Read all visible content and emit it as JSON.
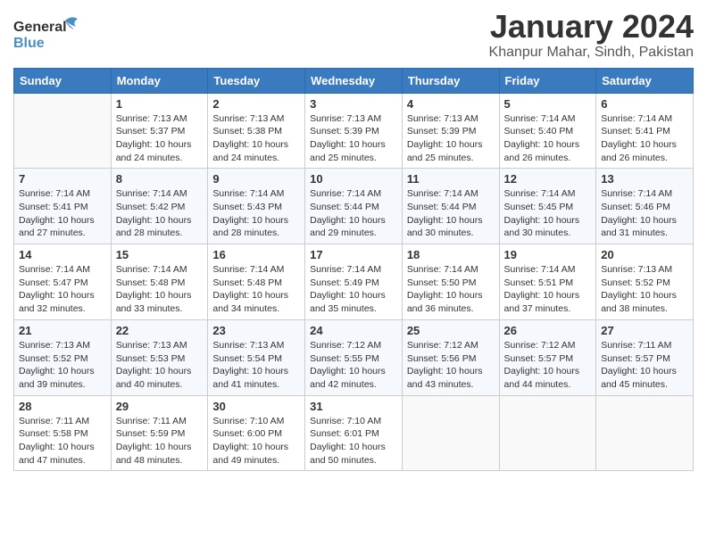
{
  "header": {
    "logo_line1": "General",
    "logo_line2": "Blue",
    "month_title": "January 2024",
    "subtitle": "Khanpur Mahar, Sindh, Pakistan"
  },
  "weekdays": [
    "Sunday",
    "Monday",
    "Tuesday",
    "Wednesday",
    "Thursday",
    "Friday",
    "Saturday"
  ],
  "weeks": [
    [
      {
        "day": "",
        "sunrise": "",
        "sunset": "",
        "daylight": ""
      },
      {
        "day": "1",
        "sunrise": "Sunrise: 7:13 AM",
        "sunset": "Sunset: 5:37 PM",
        "daylight": "Daylight: 10 hours and 24 minutes."
      },
      {
        "day": "2",
        "sunrise": "Sunrise: 7:13 AM",
        "sunset": "Sunset: 5:38 PM",
        "daylight": "Daylight: 10 hours and 24 minutes."
      },
      {
        "day": "3",
        "sunrise": "Sunrise: 7:13 AM",
        "sunset": "Sunset: 5:39 PM",
        "daylight": "Daylight: 10 hours and 25 minutes."
      },
      {
        "day": "4",
        "sunrise": "Sunrise: 7:13 AM",
        "sunset": "Sunset: 5:39 PM",
        "daylight": "Daylight: 10 hours and 25 minutes."
      },
      {
        "day": "5",
        "sunrise": "Sunrise: 7:14 AM",
        "sunset": "Sunset: 5:40 PM",
        "daylight": "Daylight: 10 hours and 26 minutes."
      },
      {
        "day": "6",
        "sunrise": "Sunrise: 7:14 AM",
        "sunset": "Sunset: 5:41 PM",
        "daylight": "Daylight: 10 hours and 26 minutes."
      }
    ],
    [
      {
        "day": "7",
        "sunrise": "Sunrise: 7:14 AM",
        "sunset": "Sunset: 5:41 PM",
        "daylight": "Daylight: 10 hours and 27 minutes."
      },
      {
        "day": "8",
        "sunrise": "Sunrise: 7:14 AM",
        "sunset": "Sunset: 5:42 PM",
        "daylight": "Daylight: 10 hours and 28 minutes."
      },
      {
        "day": "9",
        "sunrise": "Sunrise: 7:14 AM",
        "sunset": "Sunset: 5:43 PM",
        "daylight": "Daylight: 10 hours and 28 minutes."
      },
      {
        "day": "10",
        "sunrise": "Sunrise: 7:14 AM",
        "sunset": "Sunset: 5:44 PM",
        "daylight": "Daylight: 10 hours and 29 minutes."
      },
      {
        "day": "11",
        "sunrise": "Sunrise: 7:14 AM",
        "sunset": "Sunset: 5:44 PM",
        "daylight": "Daylight: 10 hours and 30 minutes."
      },
      {
        "day": "12",
        "sunrise": "Sunrise: 7:14 AM",
        "sunset": "Sunset: 5:45 PM",
        "daylight": "Daylight: 10 hours and 30 minutes."
      },
      {
        "day": "13",
        "sunrise": "Sunrise: 7:14 AM",
        "sunset": "Sunset: 5:46 PM",
        "daylight": "Daylight: 10 hours and 31 minutes."
      }
    ],
    [
      {
        "day": "14",
        "sunrise": "Sunrise: 7:14 AM",
        "sunset": "Sunset: 5:47 PM",
        "daylight": "Daylight: 10 hours and 32 minutes."
      },
      {
        "day": "15",
        "sunrise": "Sunrise: 7:14 AM",
        "sunset": "Sunset: 5:48 PM",
        "daylight": "Daylight: 10 hours and 33 minutes."
      },
      {
        "day": "16",
        "sunrise": "Sunrise: 7:14 AM",
        "sunset": "Sunset: 5:48 PM",
        "daylight": "Daylight: 10 hours and 34 minutes."
      },
      {
        "day": "17",
        "sunrise": "Sunrise: 7:14 AM",
        "sunset": "Sunset: 5:49 PM",
        "daylight": "Daylight: 10 hours and 35 minutes."
      },
      {
        "day": "18",
        "sunrise": "Sunrise: 7:14 AM",
        "sunset": "Sunset: 5:50 PM",
        "daylight": "Daylight: 10 hours and 36 minutes."
      },
      {
        "day": "19",
        "sunrise": "Sunrise: 7:14 AM",
        "sunset": "Sunset: 5:51 PM",
        "daylight": "Daylight: 10 hours and 37 minutes."
      },
      {
        "day": "20",
        "sunrise": "Sunrise: 7:13 AM",
        "sunset": "Sunset: 5:52 PM",
        "daylight": "Daylight: 10 hours and 38 minutes."
      }
    ],
    [
      {
        "day": "21",
        "sunrise": "Sunrise: 7:13 AM",
        "sunset": "Sunset: 5:52 PM",
        "daylight": "Daylight: 10 hours and 39 minutes."
      },
      {
        "day": "22",
        "sunrise": "Sunrise: 7:13 AM",
        "sunset": "Sunset: 5:53 PM",
        "daylight": "Daylight: 10 hours and 40 minutes."
      },
      {
        "day": "23",
        "sunrise": "Sunrise: 7:13 AM",
        "sunset": "Sunset: 5:54 PM",
        "daylight": "Daylight: 10 hours and 41 minutes."
      },
      {
        "day": "24",
        "sunrise": "Sunrise: 7:12 AM",
        "sunset": "Sunset: 5:55 PM",
        "daylight": "Daylight: 10 hours and 42 minutes."
      },
      {
        "day": "25",
        "sunrise": "Sunrise: 7:12 AM",
        "sunset": "Sunset: 5:56 PM",
        "daylight": "Daylight: 10 hours and 43 minutes."
      },
      {
        "day": "26",
        "sunrise": "Sunrise: 7:12 AM",
        "sunset": "Sunset: 5:57 PM",
        "daylight": "Daylight: 10 hours and 44 minutes."
      },
      {
        "day": "27",
        "sunrise": "Sunrise: 7:11 AM",
        "sunset": "Sunset: 5:57 PM",
        "daylight": "Daylight: 10 hours and 45 minutes."
      }
    ],
    [
      {
        "day": "28",
        "sunrise": "Sunrise: 7:11 AM",
        "sunset": "Sunset: 5:58 PM",
        "daylight": "Daylight: 10 hours and 47 minutes."
      },
      {
        "day": "29",
        "sunrise": "Sunrise: 7:11 AM",
        "sunset": "Sunset: 5:59 PM",
        "daylight": "Daylight: 10 hours and 48 minutes."
      },
      {
        "day": "30",
        "sunrise": "Sunrise: 7:10 AM",
        "sunset": "Sunset: 6:00 PM",
        "daylight": "Daylight: 10 hours and 49 minutes."
      },
      {
        "day": "31",
        "sunrise": "Sunrise: 7:10 AM",
        "sunset": "Sunset: 6:01 PM",
        "daylight": "Daylight: 10 hours and 50 minutes."
      },
      {
        "day": "",
        "sunrise": "",
        "sunset": "",
        "daylight": ""
      },
      {
        "day": "",
        "sunrise": "",
        "sunset": "",
        "daylight": ""
      },
      {
        "day": "",
        "sunrise": "",
        "sunset": "",
        "daylight": ""
      }
    ]
  ]
}
